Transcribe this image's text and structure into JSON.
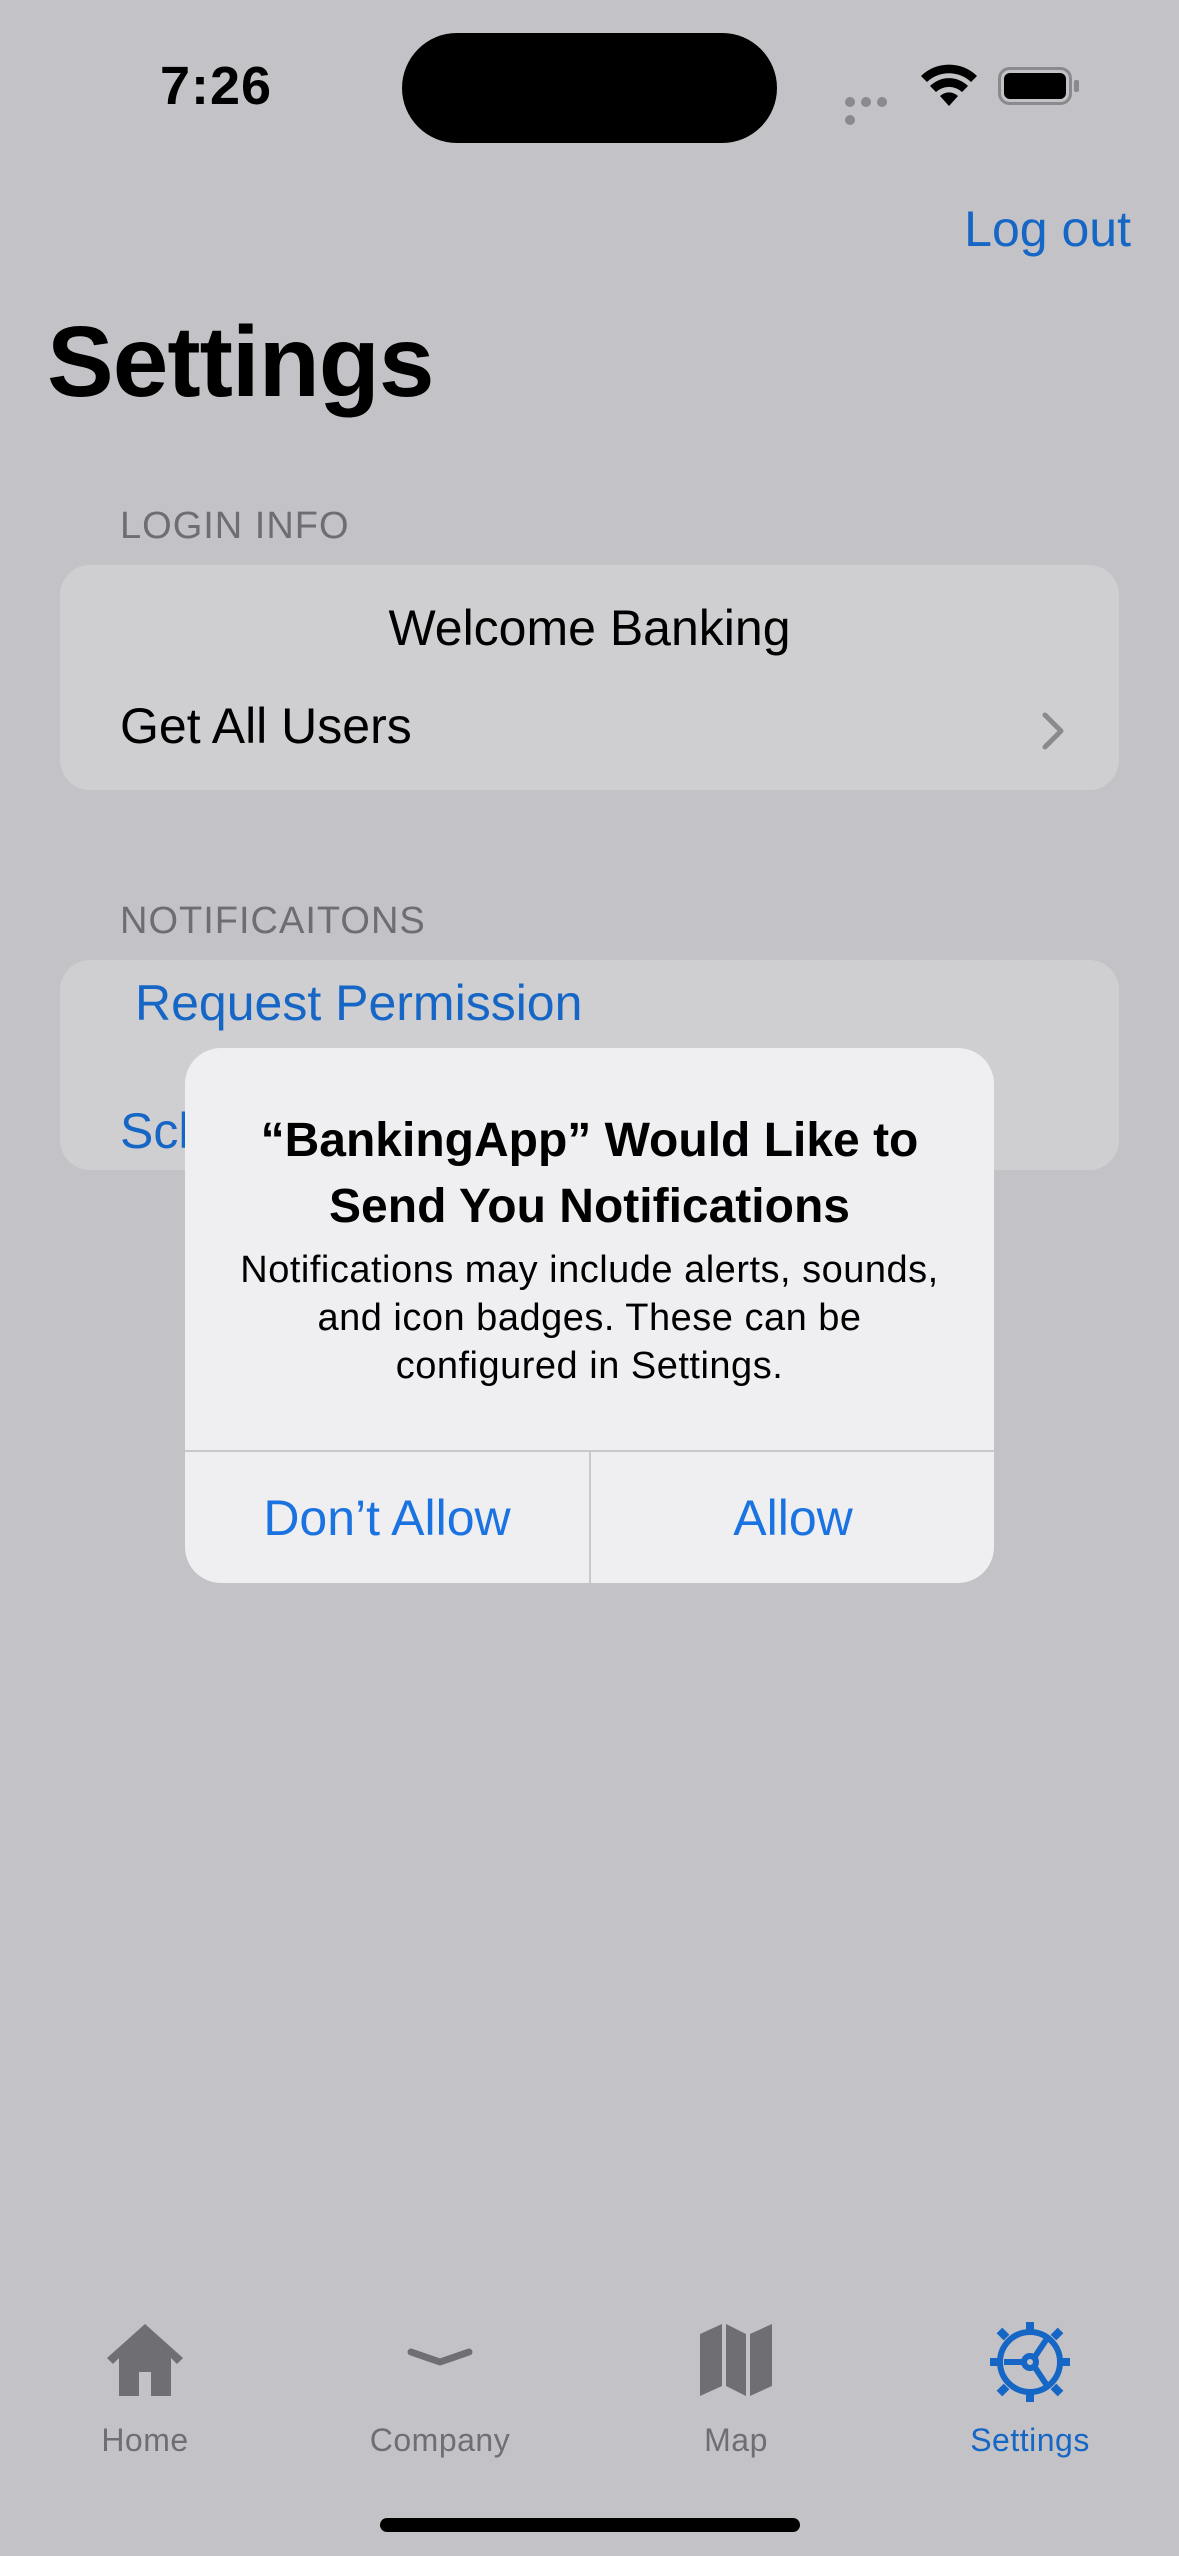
{
  "status_bar": {
    "time": "7:26"
  },
  "nav": {
    "logout_label": "Log out",
    "title": "Settings"
  },
  "sections": {
    "login": {
      "header": "LOGIN INFO",
      "welcome": "Welcome Banking",
      "get_users": "Get All Users"
    },
    "notifications": {
      "header": "NOTIFICAITONS",
      "request_permission": "Request Permission",
      "second_row_partial": "Scl"
    }
  },
  "alert": {
    "title": "“BankingApp” Would Like to Send You Notifications",
    "message": "Notifications may include alerts, sounds, and icon badges. These can be configured in Settings.",
    "dont_allow": "Don’t Allow",
    "allow": "Allow"
  },
  "tabs": [
    {
      "label": "Home",
      "icon": "house-icon"
    },
    {
      "label": "Company",
      "icon": "chevron-down-icon"
    },
    {
      "label": "Map",
      "icon": "map-icon"
    },
    {
      "label": "Settings",
      "icon": "gear-icon",
      "active": true
    }
  ],
  "colors": {
    "accent": "#1666c6",
    "background": "#c3c3c7",
    "card": "#cfcfd1",
    "alert": "#efeff1"
  }
}
